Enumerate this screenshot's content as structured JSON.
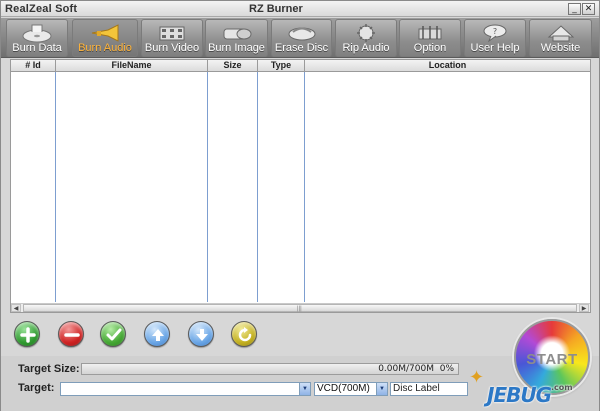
{
  "window": {
    "brand": "RealZeal Soft",
    "title": "RZ Burner",
    "minimize_glyph": "_",
    "close_glyph": "✕"
  },
  "toolbar": {
    "items": [
      {
        "label": "Burn Data",
        "icon": "disc-icon",
        "active": false
      },
      {
        "label": "Burn Audio",
        "icon": "trumpet-icon",
        "active": true
      },
      {
        "label": "Burn Video",
        "icon": "film-icon",
        "active": false
      },
      {
        "label": "Burn Image",
        "icon": "image-disc-icon",
        "active": false
      },
      {
        "label": "Erase Disc",
        "icon": "eraser-icon",
        "active": false
      },
      {
        "label": "Rip Audio",
        "icon": "rip-audio-icon",
        "active": false
      },
      {
        "label": "Option",
        "icon": "tools-icon",
        "active": false
      },
      {
        "label": "User Help",
        "icon": "help-icon",
        "active": false
      },
      {
        "label": "Website",
        "icon": "globe-icon",
        "active": false
      }
    ]
  },
  "file_table": {
    "columns": [
      "# Id",
      "FileName",
      "Size",
      "Type",
      "Location"
    ],
    "rows": [],
    "scroll_grip": "|||"
  },
  "actions": [
    {
      "name": "add-button",
      "icon": "plus-icon",
      "color": "#3aa53a"
    },
    {
      "name": "remove-button",
      "icon": "minus-icon",
      "color": "#d42a2a"
    },
    {
      "name": "check-button",
      "icon": "check-icon",
      "color": "#4caf3a"
    },
    {
      "name": "move-up-button",
      "icon": "arrow-up-icon",
      "color": "#5b9be0"
    },
    {
      "name": "move-down-button",
      "icon": "arrow-down-icon",
      "color": "#5b9be0"
    },
    {
      "name": "refresh-button",
      "icon": "refresh-icon",
      "color": "#c9b62a"
    }
  ],
  "target_size": {
    "label": "Target Size:",
    "value_text": "0.00M/700M",
    "percent_text": "0%",
    "progress": 0
  },
  "target": {
    "label": "Target:",
    "device_value": "",
    "disc_type": "VCD(700M)",
    "disc_label": "Disc Label"
  },
  "start": {
    "label": "START"
  },
  "watermark": {
    "text": "JEBUG",
    "suffix": ".com"
  }
}
